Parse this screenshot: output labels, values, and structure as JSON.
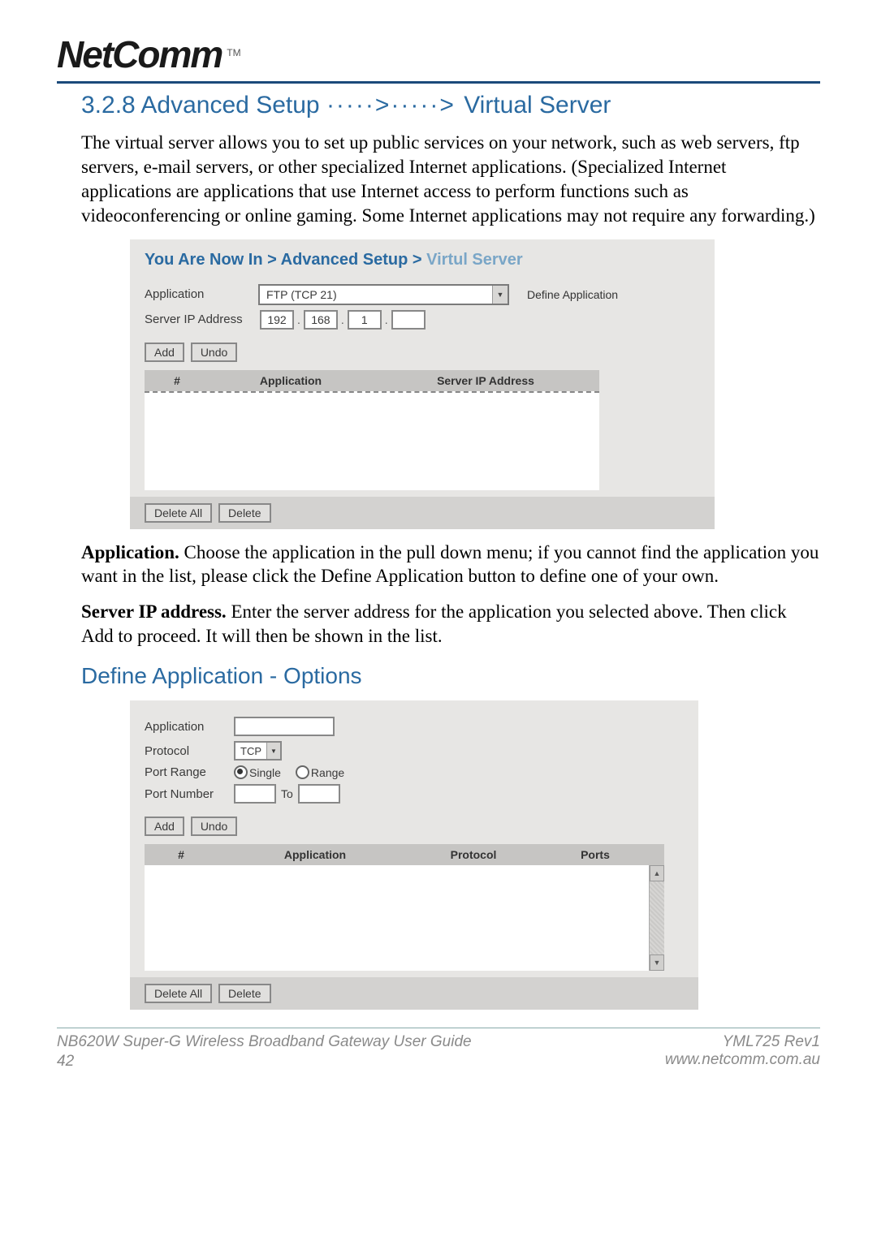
{
  "logo": {
    "brand": "NetComm",
    "tm": "TM"
  },
  "section_title": {
    "num": "3.2.8",
    "a": "Advanced Setup",
    "b": "Virtual Server"
  },
  "intro": "The virtual server allows you to set up public services on your network, such as web servers, ftp servers, e-mail servers, or other specialized Internet applications. (Specialized Internet applications are applications that use Internet access to perform functions such as videoconferencing or online gaming. Some Internet applications may not require any forwarding.)",
  "panel1": {
    "breadcrumb": {
      "prefix": "You Are Now In >",
      "mid": "Advanced Setup >",
      "leaf": "Virtul Server"
    },
    "application_label": "Application",
    "application_value": "FTP (TCP 21)",
    "define_label": "Define Application",
    "ip_label": "Server IP Address",
    "ip": [
      "192",
      "168",
      "1",
      ""
    ],
    "add": "Add",
    "undo": "Undo",
    "cols": {
      "idx": "#",
      "app": "Application",
      "ip": "Server IP Address"
    },
    "delete_all": "Delete All",
    "delete": "Delete"
  },
  "para_app": {
    "bold": "Application.",
    "rest": " Choose the application in the pull down menu; if you cannot find the application you want in the list, please click the Define Application button to define one of your own."
  },
  "para_ip": {
    "bold": "Server IP address.",
    "rest": " Enter the server address for the application you selected above. Then click Add to proceed. It will then be shown in the list."
  },
  "subhead": "Define Application - Options",
  "panel2": {
    "application_label": "Application",
    "protocol_label": "Protocol",
    "protocol_value": "TCP",
    "portrange_label": "Port Range",
    "single": "Single",
    "range": "Range",
    "portnum_label": "Port Number",
    "to": "To",
    "add": "Add",
    "undo": "Undo",
    "cols": {
      "idx": "#",
      "app": "Application",
      "proto": "Protocol",
      "ports": "Ports"
    },
    "delete_all": "Delete All",
    "delete": "Delete"
  },
  "footer": {
    "guide": "NB620W Super-G Wireless Broadband  Gateway User Guide",
    "rev": "YML725 Rev1",
    "url": "www.netcomm.com.au",
    "page": "42"
  }
}
